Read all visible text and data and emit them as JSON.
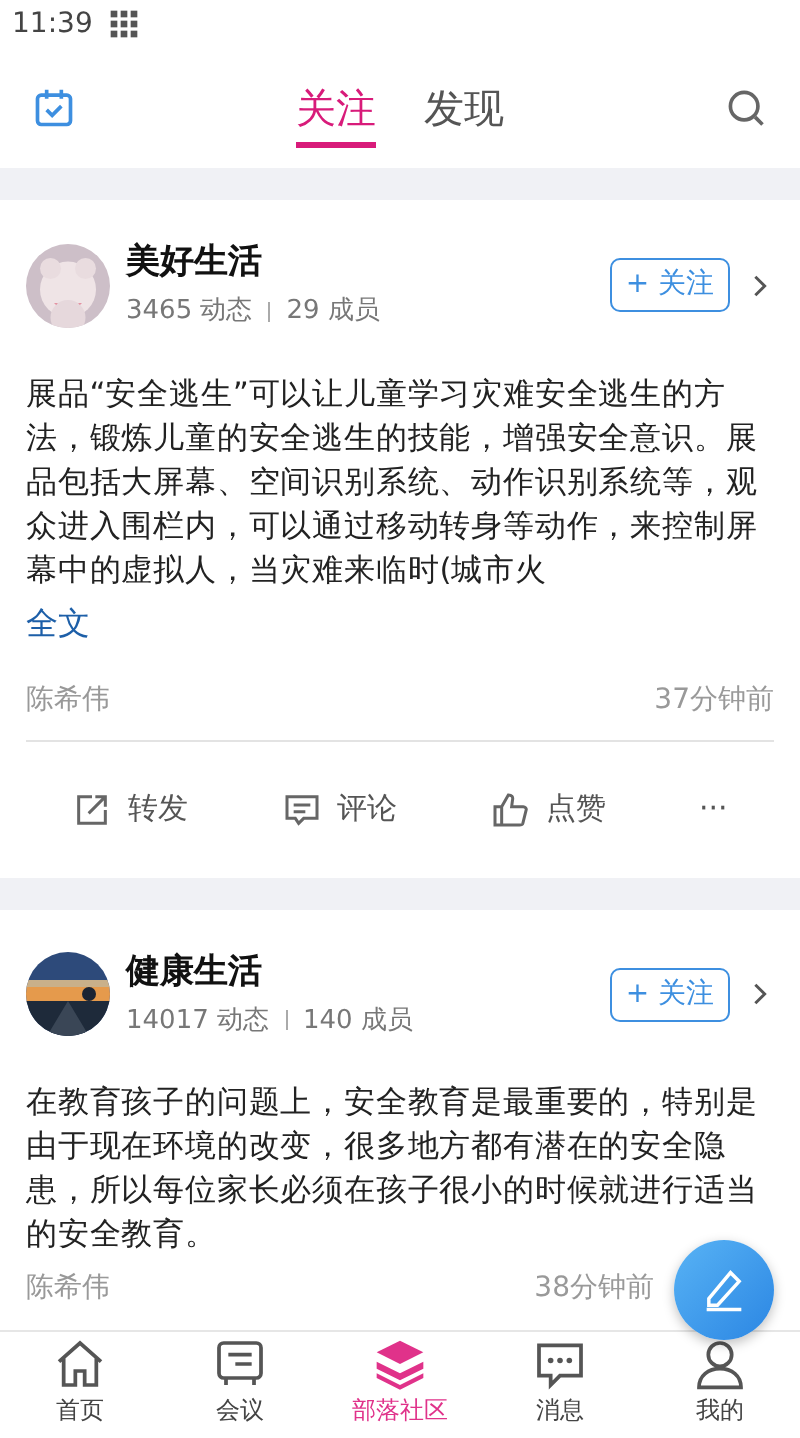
{
  "status_bar": {
    "time": "11:39"
  },
  "header": {
    "tabs": [
      {
        "label": "关注",
        "selected": true
      },
      {
        "label": "发现",
        "selected": false
      }
    ]
  },
  "posts": [
    {
      "group": "美好生活",
      "posts_count": "3465 动态",
      "members": "29 成员",
      "follow_label": "+ 关注",
      "text": "展品“安全逃生”可以让儿童学习灾难安全逃生的方法，锻炼儿童的安全逃生的技能，增强安全意识。展品包括大屏幕、空间识别系统、动作识别系统等，观众进入围栏内，可以通过移动转身等动作，来控制屏幕中的虚拟人，当灾难来临时(城市火",
      "more_link": "全文",
      "author": "陈希伟",
      "time": "37分钟前",
      "actions": [
        {
          "kind": "share",
          "label": "转发"
        },
        {
          "kind": "comment",
          "label": "评论"
        },
        {
          "kind": "like",
          "label": "点赞"
        },
        {
          "kind": "more",
          "label": "···"
        }
      ]
    },
    {
      "group": "健康生活",
      "posts_count": "14017 动态",
      "members": "140 成员",
      "follow_label": "+ 关注",
      "text": "在教育孩子的问题上，安全教育是最重要的，特别是由于现在环境的改变，很多地方都有潜在的安全隐患，所以每位家长必须在孩子很小的时候就进行适当的安全教育。",
      "author": "陈希伟",
      "time": "38分钟前"
    }
  ],
  "bottom_nav": [
    {
      "kind": "home",
      "label": "首页",
      "selected": false
    },
    {
      "kind": "meeting",
      "label": "会议",
      "selected": false
    },
    {
      "kind": "community",
      "label": "部落社区",
      "selected": true
    },
    {
      "kind": "message",
      "label": "消息",
      "selected": false
    },
    {
      "kind": "profile",
      "label": "我的",
      "selected": false
    }
  ]
}
